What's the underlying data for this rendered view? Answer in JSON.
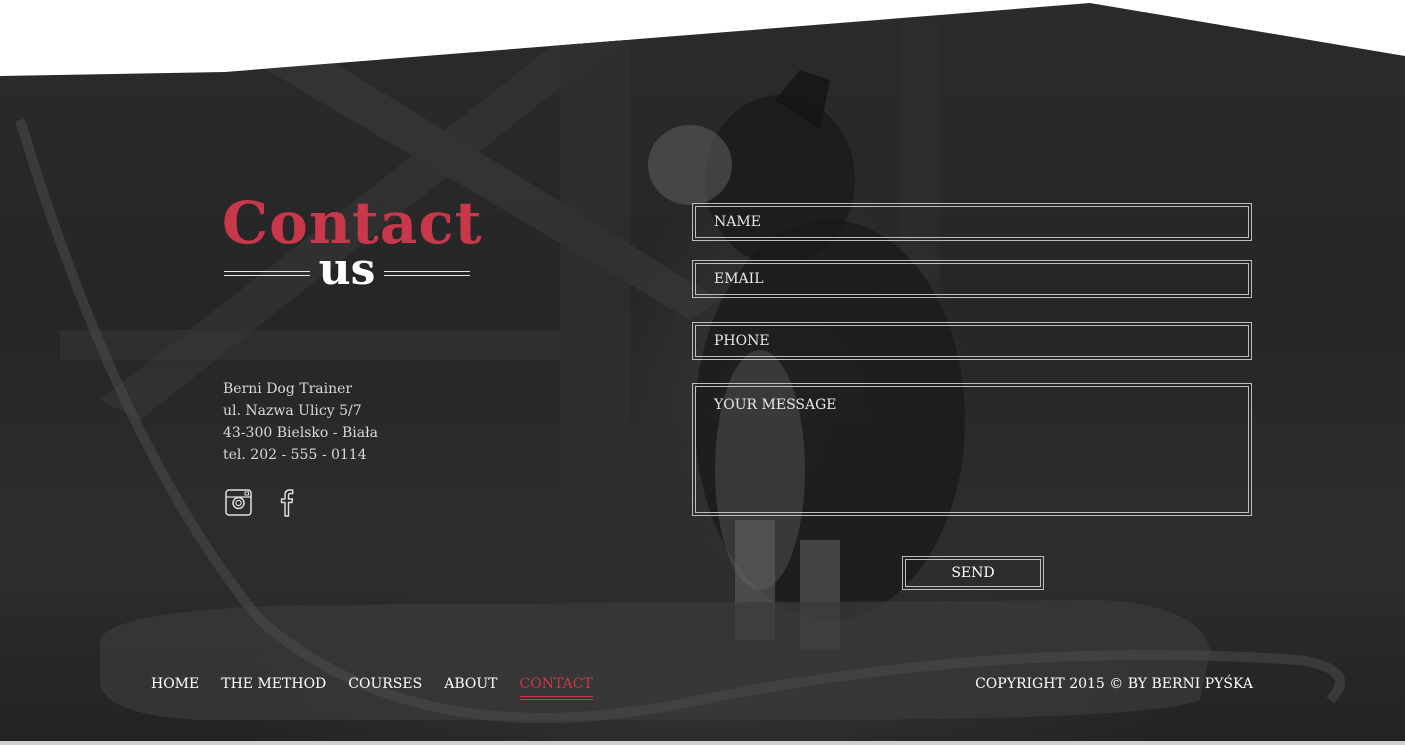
{
  "title": {
    "line1": "Contact",
    "line2": "us"
  },
  "address": {
    "lines": [
      "Berni Dog Trainer",
      "ul. Nazwa Ulicy 5/7",
      "43-300 Bielsko - Biała",
      "tel. 202 - 555 - 0114"
    ]
  },
  "social": [
    "instagram-icon",
    "facebook-icon"
  ],
  "form": {
    "name_placeholder": "NAME",
    "email_placeholder": "EMAIL",
    "phone_placeholder": "PHONE",
    "message_placeholder": "YOUR MESSAGE",
    "send_label": "SEND"
  },
  "nav": {
    "items": [
      "HOME",
      "THE METHOD",
      "COURSES",
      "ABOUT",
      "CONTACT"
    ],
    "active": "CONTACT"
  },
  "footer": {
    "copyright": "COPYRIGHT 2015  ©  BY BERNI PYŚKA"
  },
  "colors": {
    "accent": "#c9374a",
    "text": "#ffffff",
    "background": "#282828"
  }
}
